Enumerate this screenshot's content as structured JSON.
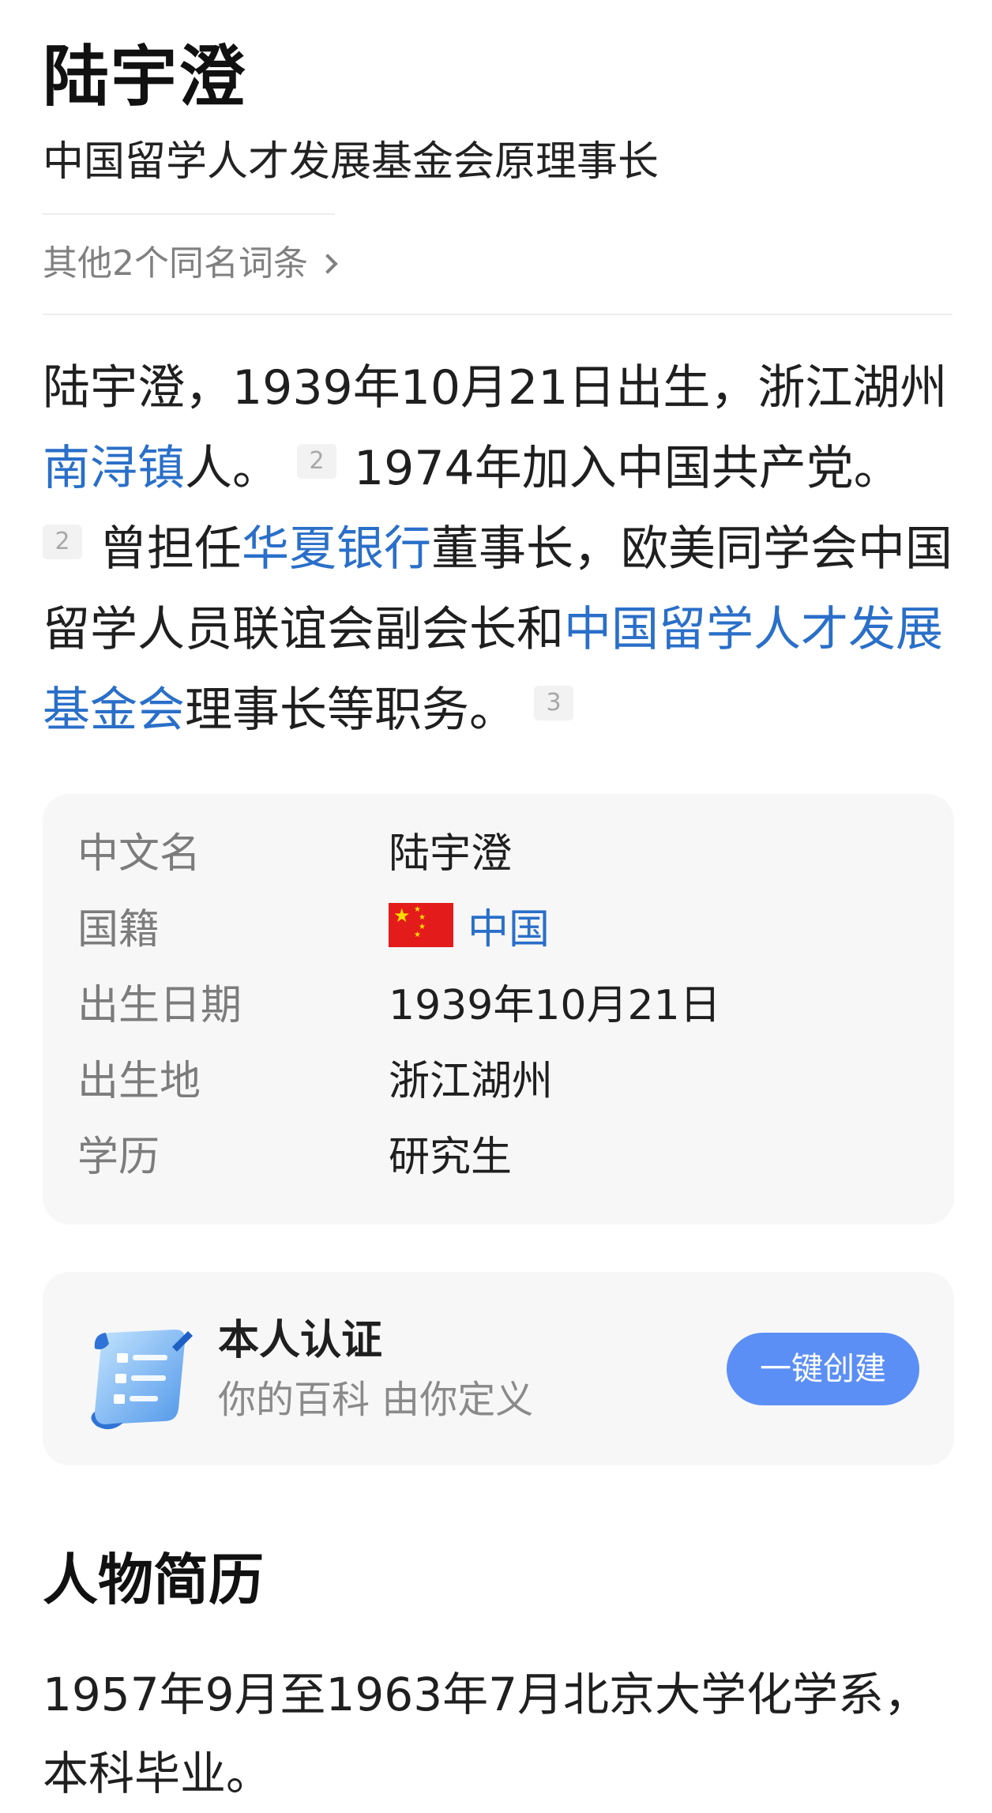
{
  "entry": {
    "title": "陆宇澄",
    "subtitle": "中国留学人才发展基金会原理事长",
    "namesake_link": "其他2个同名词条"
  },
  "summary": {
    "part1": "陆宇澄，1939年10月21日出生，浙江湖州",
    "link1": "南浔镇",
    "part2": "人。",
    "ref1": "2",
    "part3": "1974年加入中国共产党。",
    "ref2": "2",
    "part4": "曾担任",
    "link2": "华夏银行",
    "part5": "董事长，欧美同学会中国留学人员联谊会副会长和",
    "link3": "中国留学人才发展基金会",
    "part6": "理事长等职务。",
    "ref3": "3"
  },
  "infobox": {
    "rows": [
      {
        "key": "中文名",
        "value": "陆宇澄"
      },
      {
        "key": "国籍",
        "value": "中国"
      },
      {
        "key": "出生日期",
        "value": "1939年10月21日"
      },
      {
        "key": "出生地",
        "value": "浙江湖州"
      },
      {
        "key": "学历",
        "value": "研究生"
      }
    ]
  },
  "certification": {
    "title": "本人认证",
    "subtitle": "你的百科 由你定义",
    "button": "一键创建"
  },
  "biography": {
    "heading": "人物简历",
    "text": "1957年9月至1963年7月北京大学化学系，本科毕业。"
  },
  "colors": {
    "link": "#2a6fc9",
    "button": "#5b8ff5",
    "card_bg": "#f7f7f8"
  },
  "icons": [
    "chevron-right-icon",
    "china-flag-icon",
    "certificate-scroll-icon"
  ]
}
